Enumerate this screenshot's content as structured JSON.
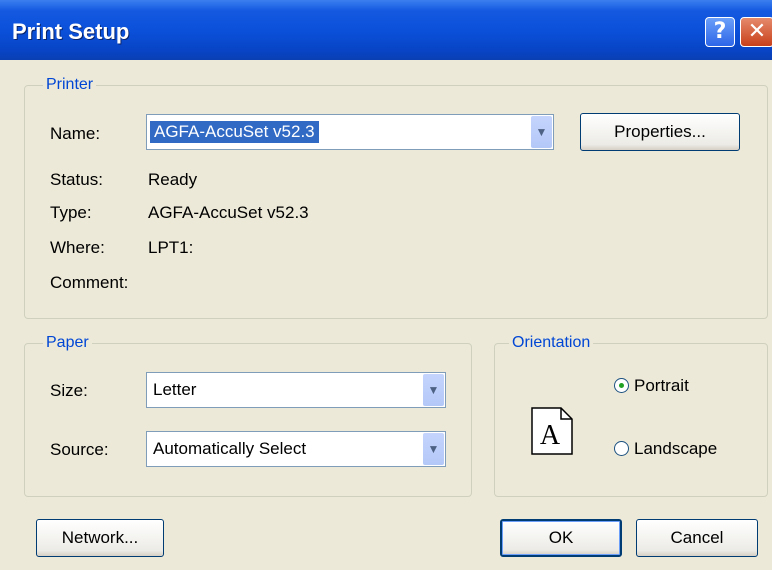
{
  "window": {
    "title": "Print Setup",
    "help_glyph": "?",
    "close_glyph": "✕"
  },
  "printer": {
    "legend": "Printer",
    "name_label": "Name:",
    "name_value": "AGFA-AccuSet v52.3",
    "properties_button": "Properties...",
    "status_label": "Status:",
    "status_value": "Ready",
    "type_label": "Type:",
    "type_value": "AGFA-AccuSet v52.3",
    "where_label": "Where:",
    "where_value": "LPT1:",
    "comment_label": "Comment:"
  },
  "paper": {
    "legend": "Paper",
    "size_label": "Size:",
    "size_value": "Letter",
    "source_label": "Source:",
    "source_value": "Automatically Select"
  },
  "orientation": {
    "legend": "Orientation",
    "preview_letter": "A",
    "portrait_label": "Portrait",
    "landscape_label": "Landscape",
    "selected": "Portrait"
  },
  "buttons": {
    "network": "Network...",
    "ok": "OK",
    "cancel": "Cancel"
  },
  "icons": {
    "dropdown": "chevron-down-icon",
    "help": "help-icon",
    "close": "close-icon",
    "page": "portrait-page-icon"
  }
}
